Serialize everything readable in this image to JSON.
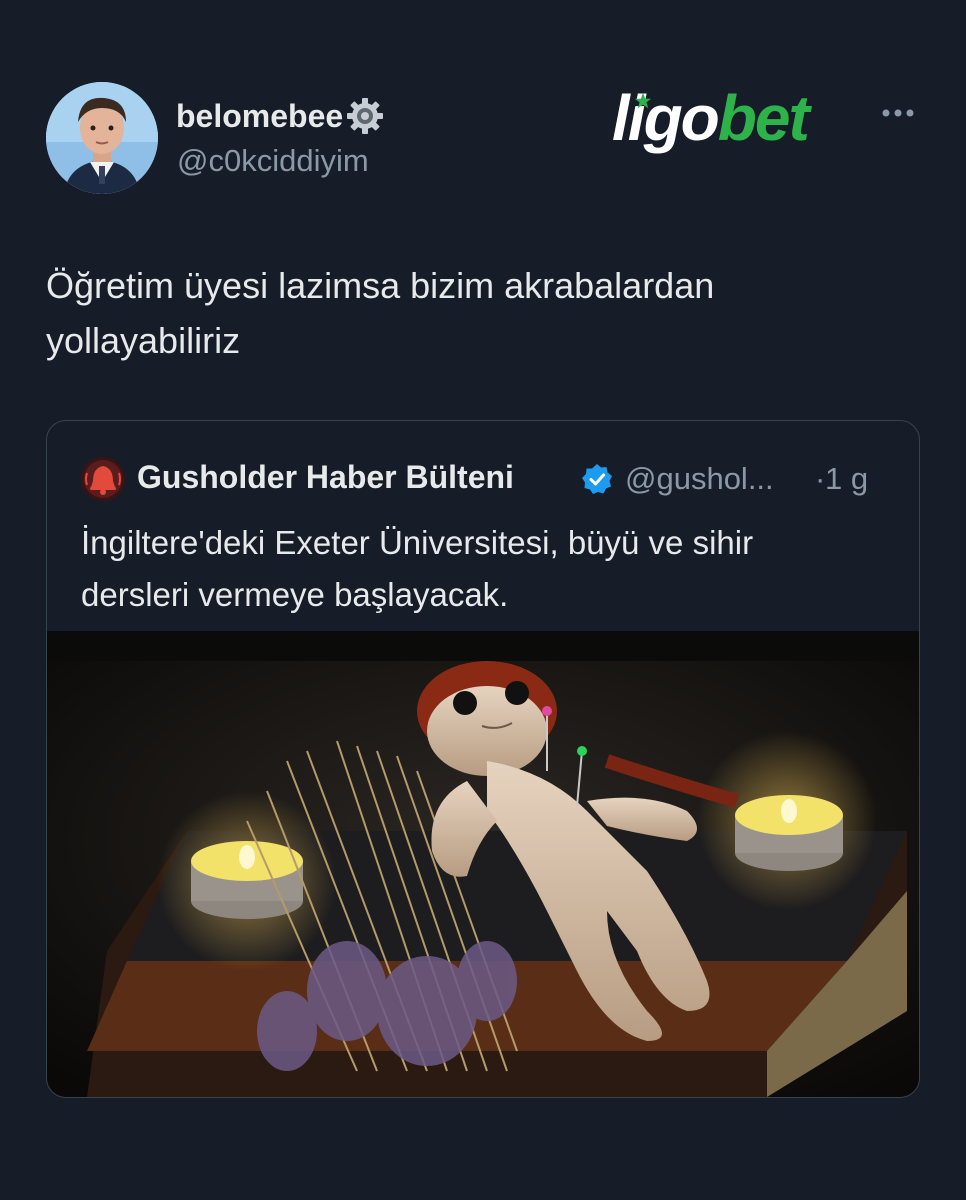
{
  "author": {
    "display_name": "belomebee",
    "handle": "@c0kciddiyim",
    "badge_icon": "gear-icon",
    "avatar_icon": "profile-photo"
  },
  "brand": {
    "part1": "ligo",
    "part2": "bet",
    "accent_color": "#2db34a"
  },
  "menu": {
    "icon": "more-icon"
  },
  "tweet": {
    "text_line1": "Öğretim üyesi lazimsa bizim akrabalardan",
    "text_line2": "yollayabiliriz"
  },
  "quoted": {
    "name": "Gusholder Haber Bülteni",
    "verified_icon": "verified-icon",
    "handle": "@gushol...",
    "separator": "·",
    "time": "1 g",
    "text_line1": "İngiltere'deki Exeter Üniversitesi, büyü ve sihir",
    "text_line2": "dersleri vermeye başlayacak.",
    "avatar_icon": "bell-icon"
  },
  "colors": {
    "background": "#161d28",
    "text_primary": "#e7e9ea",
    "text_secondary": "#8b98a5",
    "card_border": "#38444d",
    "verified": "#1d9bf0"
  }
}
